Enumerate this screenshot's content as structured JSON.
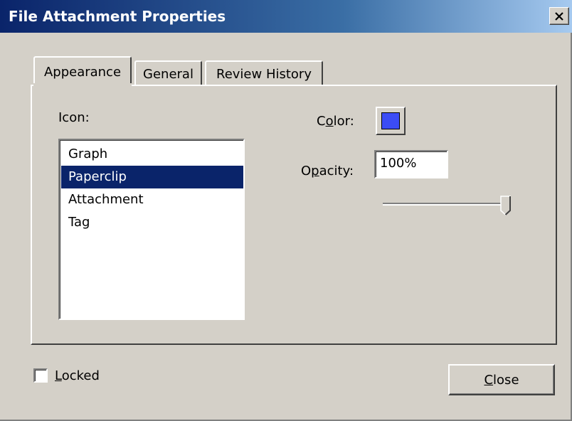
{
  "window": {
    "title": "File Attachment Properties",
    "close_glyph": "×"
  },
  "tabs": [
    {
      "label": "Appearance",
      "active": true
    },
    {
      "label": "General",
      "active": false
    },
    {
      "label": "Review History",
      "active": false
    }
  ],
  "appearance": {
    "icon_label": "Icon:",
    "icon_list": [
      "Graph",
      "Paperclip",
      "Attachment",
      "Tag"
    ],
    "selected_icon": "Paperclip",
    "color_label": {
      "pre": "C",
      "mnemonic": "o",
      "post": "lor:"
    },
    "color_value": "#3b4cf5",
    "opacity_label": {
      "pre": "O",
      "mnemonic": "p",
      "post": "acity:"
    },
    "opacity_value": "100%",
    "opacity_slider_level": 1.0
  },
  "footer": {
    "locked_label": {
      "mnemonic": "L",
      "post": "ocked"
    },
    "locked_checked": false,
    "close_label": {
      "mnemonic": "C",
      "post": "lose"
    }
  },
  "colors": {
    "selection": "#0a246a",
    "titlebar_start": "#0a246a",
    "face": "#d4d0c8"
  }
}
